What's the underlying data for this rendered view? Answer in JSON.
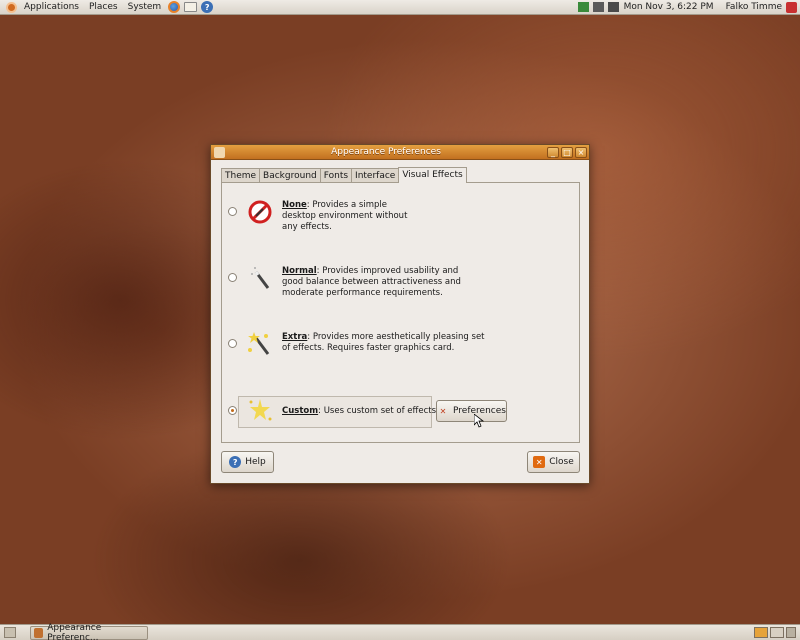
{
  "top_panel": {
    "menus": [
      "Applications",
      "Places",
      "System"
    ],
    "clock": "Mon Nov  3,  6:22 PM",
    "username": "Falko Timme"
  },
  "window": {
    "title": "Appearance Preferences",
    "tabs": [
      "Theme",
      "Background",
      "Fonts",
      "Interface",
      "Visual Effects"
    ],
    "active_tab": "Visual Effects",
    "options": [
      {
        "name": "None",
        "text": "Provides a simple\ndesktop environment without\nany effects.",
        "selected": false
      },
      {
        "name": "Normal",
        "text": "Provides improved usability and\ngood balance between attractiveness and\nmoderate performance requirements.",
        "selected": false
      },
      {
        "name": "Extra",
        "text": "Provides more aesthetically pleasing set\nof effects. Requires faster graphics card.",
        "selected": false
      },
      {
        "name": "Custom",
        "text": "Uses custom set of effects.",
        "selected": true
      }
    ],
    "preferences_label": "Preferences",
    "help_label": "Help",
    "close_label": "Close"
  },
  "bottom_panel": {
    "task_label": "Appearance Preferenc..."
  },
  "colors": {
    "accent": "#e4a040",
    "radio_dot": "#c36b1b"
  }
}
